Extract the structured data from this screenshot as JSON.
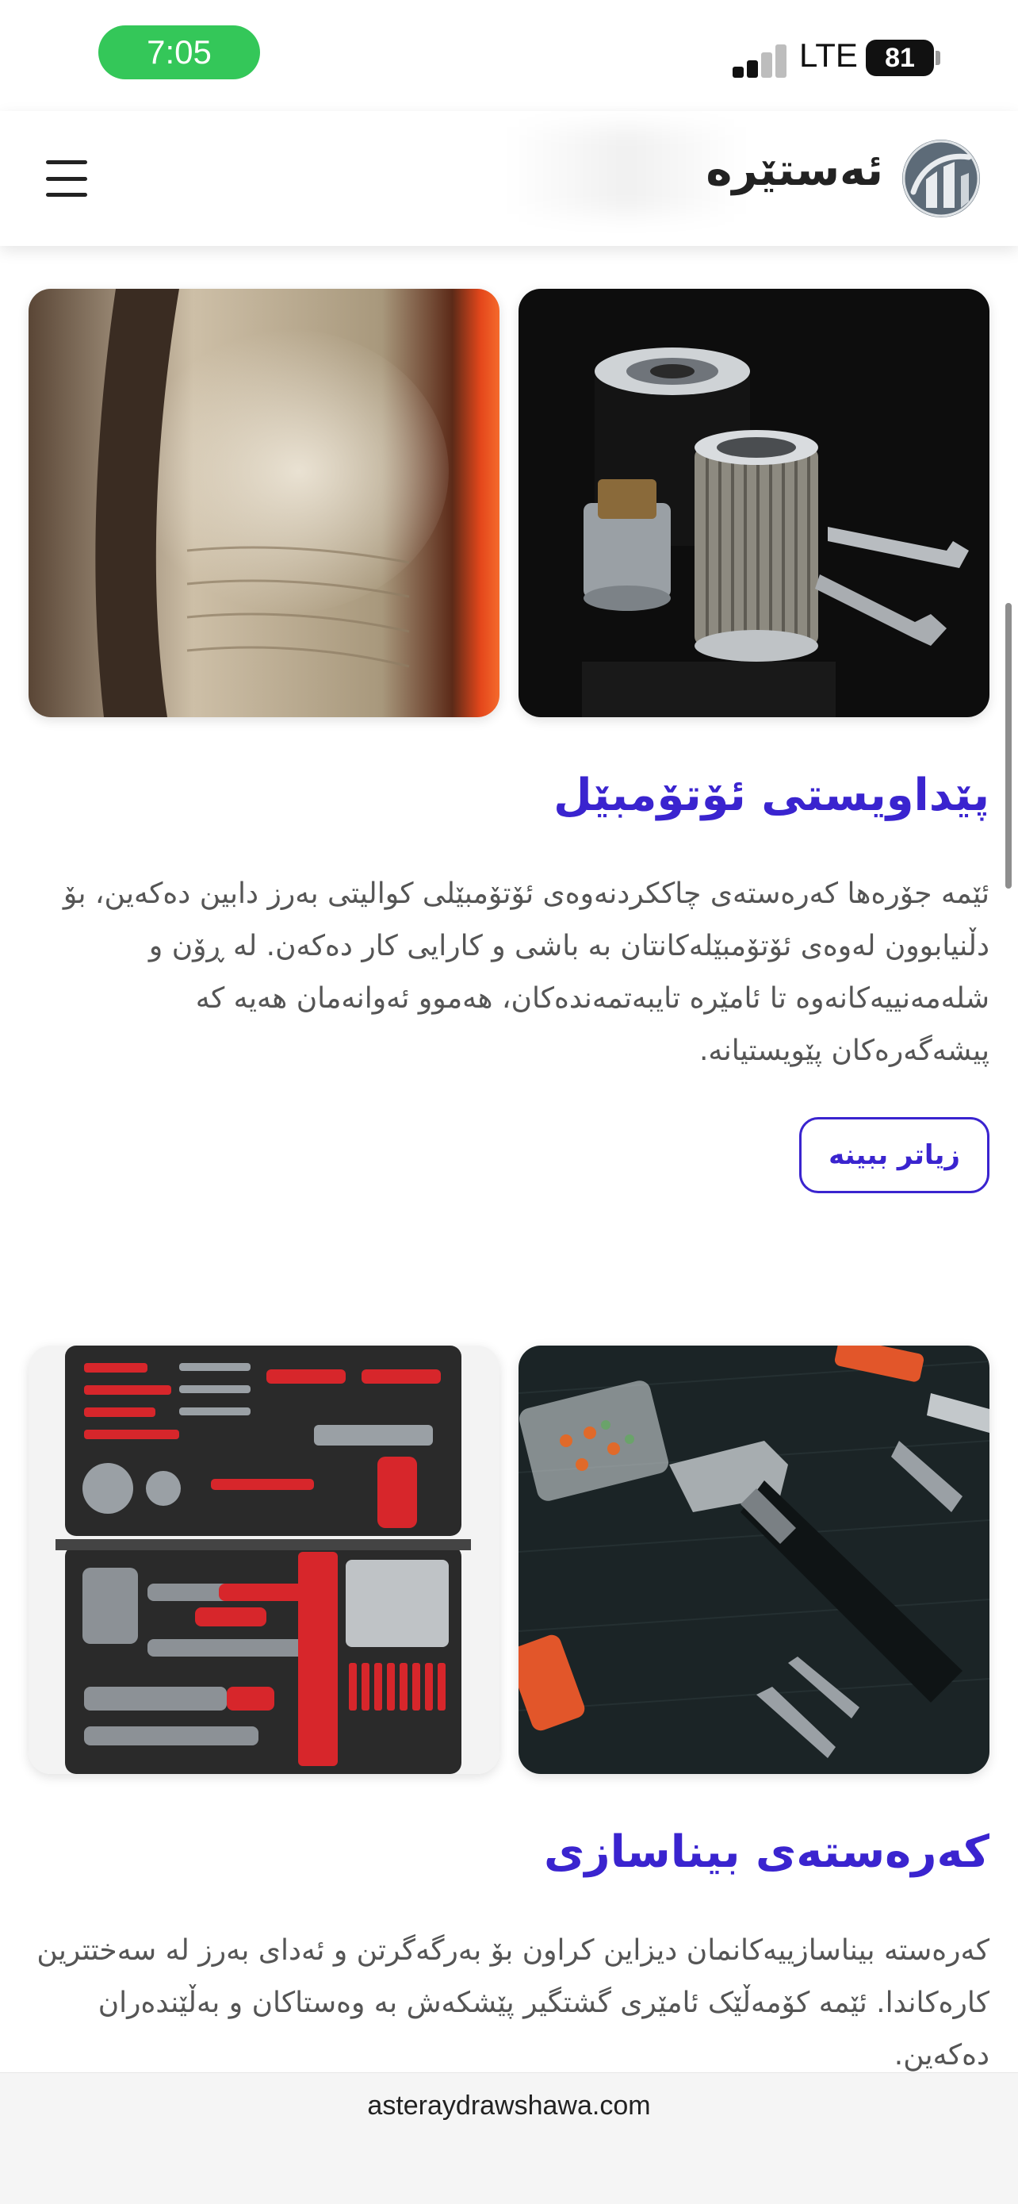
{
  "status_bar": {
    "time": "7:05",
    "network": "LTE",
    "battery": "81"
  },
  "header": {
    "brand": "ئەستێرە"
  },
  "sections": [
    {
      "title": "پێداویستی ئۆتۆمبێل",
      "paragraph": "ئێمە جۆرەها کەرەستەی چاککردنەوەی ئۆتۆمبێلی کوالیتی بەرز دابین دەکەین، بۆ دڵنیابوون لەوەی ئۆتۆمبێلەکانتان بە باشی و کارایی کار دەکەن. لە ڕۆن و شلەمەنییەکانەوە تا ئامێرە تایبەتمەندەکان، هەموو ئەوانەمان هەیە کە پیشەگەرەکان پێویستیانە.",
      "button": "زیاتر ببینە"
    },
    {
      "title": "کەرەستەی بیناسازی",
      "paragraph": "کەرەستە بیناسازییەکانمان دیزاین کراون بۆ بەرگەگرتن و ئەدای بەرز لە سەختترین کارەکاندا. ئێمە کۆمەڵێک ئامێری گشتگیر پێشکەش بە وەستاکان و بەڵێندەران دەکەین."
    }
  ],
  "browser": {
    "url": "asteraydrawshawa.com"
  }
}
